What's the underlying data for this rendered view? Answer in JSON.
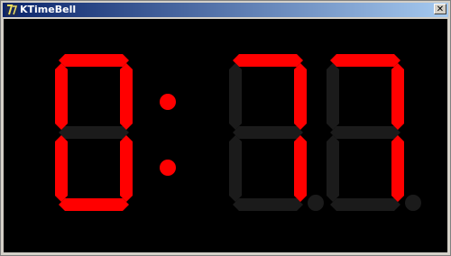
{
  "window": {
    "title": "KTimeBell",
    "icon": "ktimebell-app-icon",
    "close_glyph": "✕"
  },
  "clock": {
    "digits": [
      "0",
      "7",
      "7"
    ],
    "colon": true,
    "decimal_points": [
      false,
      false,
      false
    ],
    "colors": {
      "on": "#ff0000",
      "off": "#1b1b1b",
      "background": "#000000"
    }
  }
}
